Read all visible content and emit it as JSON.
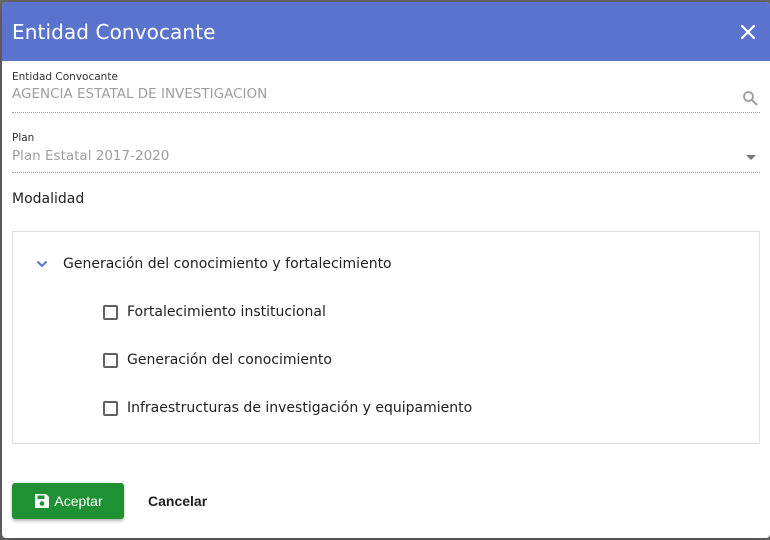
{
  "dialog": {
    "title": "Entidad Convocante",
    "header_color": "#5a74cd"
  },
  "entidad_field": {
    "label": "Entidad Convocante",
    "value": "AGENCIA ESTATAL DE INVESTIGACION",
    "icon": "search-icon"
  },
  "plan_field": {
    "label": "Plan",
    "value": "Plan Estatal 2017-2020",
    "icon": "dropdown-arrow-icon"
  },
  "modalidad": {
    "title": "Modalidad",
    "tree": {
      "parent": {
        "label": "Generación del conocimiento y fortalecimiento",
        "expanded": true,
        "icon": "chevron-down-icon"
      },
      "children": [
        {
          "label": "Fortalecimiento institucional",
          "checked": false
        },
        {
          "label": "Generación del conocimiento",
          "checked": false
        },
        {
          "label": "Infraestructuras de investigación y equipamiento",
          "checked": false
        }
      ]
    }
  },
  "footer": {
    "accept_label": "Aceptar",
    "cancel_label": "Cancelar",
    "accept_color": "#1f9133",
    "accept_icon": "save-icon"
  }
}
